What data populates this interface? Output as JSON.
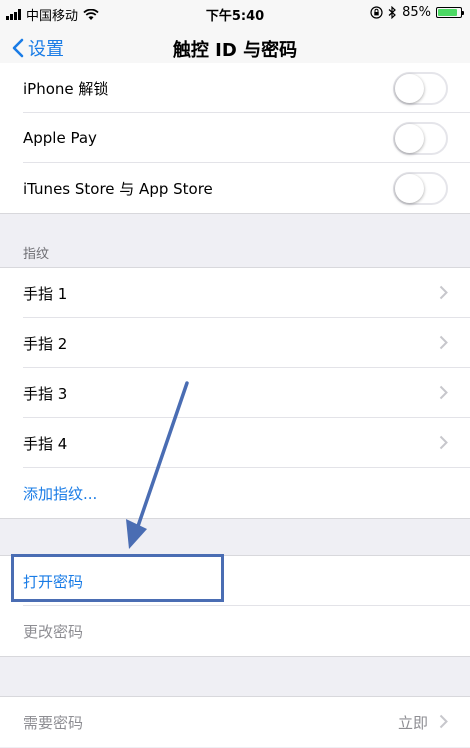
{
  "status_bar": {
    "carrier": "中国移动",
    "time": "下午5:40",
    "battery_percent": "85%",
    "battery_level": 0.85
  },
  "nav": {
    "back_label": "设置",
    "title": "触控 ID 与密码"
  },
  "toggles": [
    {
      "label": "iPhone 解锁",
      "on": false
    },
    {
      "label": "Apple Pay",
      "on": false
    },
    {
      "label": "iTunes Store 与 App Store",
      "on": false
    }
  ],
  "fingerprint_section": {
    "header": "指纹",
    "fingers": [
      {
        "label": "手指 1"
      },
      {
        "label": "手指 2"
      },
      {
        "label": "手指 3"
      },
      {
        "label": "手指 4"
      }
    ],
    "add_label": "添加指纹..."
  },
  "passcode_section": {
    "turn_on_label": "打开密码",
    "change_label": "更改密码"
  },
  "require_passcode": {
    "label": "需要密码",
    "value": "立即"
  },
  "colors": {
    "accent": "#1a7ce6",
    "annotation": "#4a6db3",
    "background": "#efeff4"
  }
}
